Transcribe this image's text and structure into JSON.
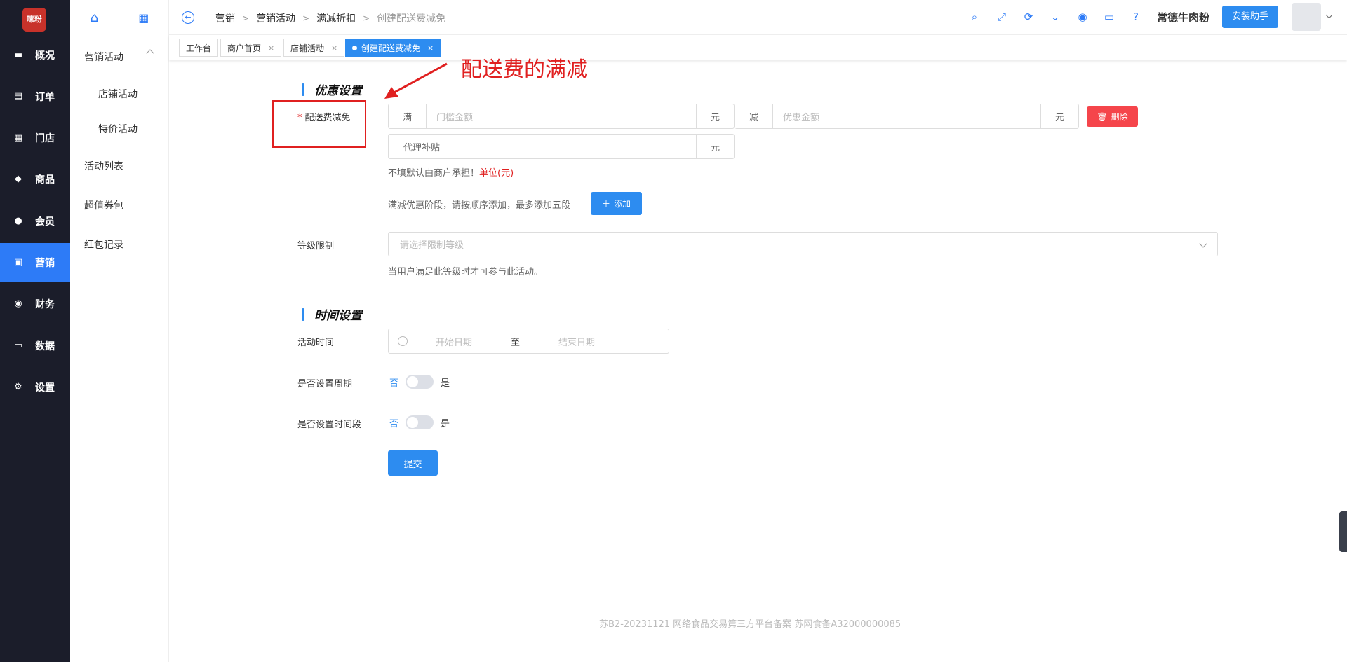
{
  "nav": {
    "logo_text": "嗦粉",
    "items": [
      {
        "label": "概况",
        "icon": "overview-icon"
      },
      {
        "label": "订单",
        "icon": "order-icon"
      },
      {
        "label": "门店",
        "icon": "store-icon"
      },
      {
        "label": "商品",
        "icon": "goods-icon"
      },
      {
        "label": "会员",
        "icon": "member-icon"
      },
      {
        "label": "营销",
        "icon": "marketing-icon"
      },
      {
        "label": "财务",
        "icon": "finance-icon"
      },
      {
        "label": "数据",
        "icon": "data-icon"
      },
      {
        "label": "设置",
        "icon": "settings-icon"
      }
    ]
  },
  "submenu": {
    "group": "营销活动",
    "children": [
      "店铺活动",
      "特价活动"
    ],
    "items": [
      "活动列表",
      "超值券包",
      "红包记录"
    ]
  },
  "header": {
    "crumbs": [
      "营销",
      "营销活动",
      "满减折扣",
      "创建配送费减免"
    ],
    "shop_name": "常德牛肉粉",
    "install_label": "安装助手"
  },
  "tabs": [
    "工作台",
    "商户首页",
    "店铺活动",
    "创建配送费减免"
  ],
  "annotation": {
    "text": "配送费的满减"
  },
  "form": {
    "discount_section": "优惠设置",
    "delivery_label": "配送费减免",
    "full_prefix": "满",
    "full_placeholder": "门槛金额",
    "unit": "元",
    "minus_prefix": "减",
    "minus_placeholder": "优惠金额",
    "delete_label": "删除",
    "subsidy_prefix": "代理补贴",
    "subsidy_hint": "不填默认由商户承担！",
    "subsidy_unit_hint": "单位(元)",
    "tier_hint": "满减优惠阶段，请按顺序添加，最多添加五段",
    "add_label": "添加",
    "level_label": "等级限制",
    "level_placeholder": "请选择限制等级",
    "level_hint": "当用户满足此等级时才可参与此活动。",
    "time_section": "时间设置",
    "time_label": "活动时间",
    "start_placeholder": "开始日期",
    "to_text": "至",
    "end_placeholder": "结束日期",
    "cycle_label": "是否设置周期",
    "period_label": "是否设置时间段",
    "no_text": "否",
    "yes_text": "是",
    "submit_label": "提交"
  },
  "footer": "苏B2-20231121  网络食品交易第三方平台备案 苏网食备A32000000085",
  "colors": {
    "primary": "#2d8cf0",
    "nav_bg": "#1b1d2a",
    "danger": "#f5454b",
    "annotation": "#e02020"
  }
}
